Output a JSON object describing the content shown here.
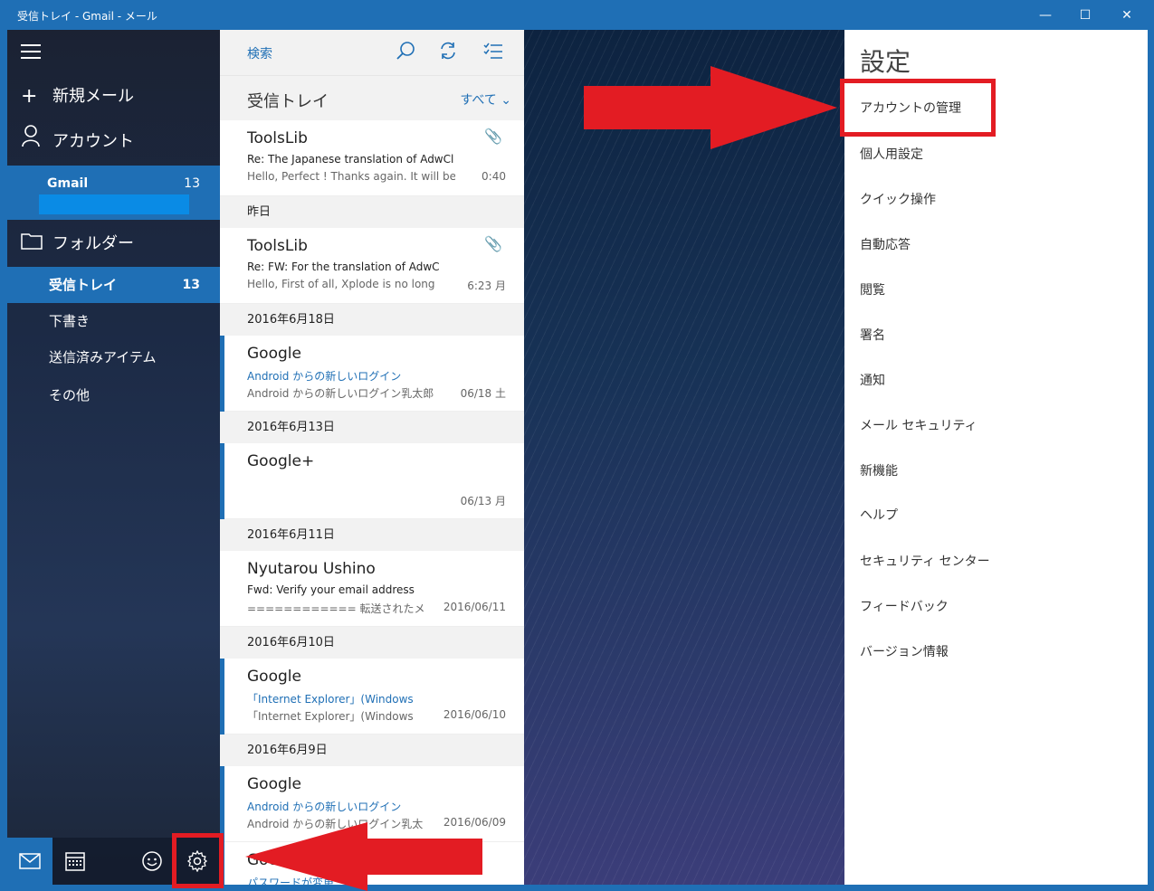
{
  "window": {
    "title": "受信トレイ - Gmail - メール",
    "controls": [
      "—",
      "☐",
      "✕"
    ]
  },
  "nav": {
    "new_mail": "新規メール",
    "accounts": "アカウント",
    "account": {
      "name": "Gmail",
      "count": "13"
    },
    "folders_label": "フォルダー",
    "folders": [
      {
        "label": "受信トレイ",
        "count": "13"
      },
      {
        "label": "下書き",
        "count": ""
      },
      {
        "label": "送信済みアイテム",
        "count": ""
      },
      {
        "label": "その他",
        "count": ""
      }
    ]
  },
  "list": {
    "search_placeholder": "検索",
    "inbox_title": "受信トレイ",
    "filter": "すべて",
    "messages": [
      {
        "from": "ToolsLib",
        "subject": "Re: The Japanese translation of AdwCl",
        "preview": "Hello, Perfect ! Thanks again. It will be",
        "time": "0:40"
      },
      {
        "group": "昨日"
      },
      {
        "from": "ToolsLib",
        "subject": "Re: FW: For the translation of AdwC",
        "preview": "Hello, First of all, Xplode is no long",
        "time": "6:23 月"
      },
      {
        "group": "2016年6月18日"
      },
      {
        "from": "Google",
        "subject": "Android からの新しいログイン",
        "preview": "Android からの新しいログイン乳太郎",
        "time": "06/18 土"
      },
      {
        "group": "2016年6月13日"
      },
      {
        "from": "Google+",
        "subject": "",
        "preview": "",
        "time": "06/13 月"
      },
      {
        "group": "2016年6月11日"
      },
      {
        "from": "Nyutarou Ushino",
        "subject": "Fwd:  Verify your email address",
        "preview": "============ 転送されたメ",
        "time": "2016/06/11"
      },
      {
        "group": "2016年6月10日"
      },
      {
        "from": "Google",
        "subject": "「Internet Explorer」(Windows",
        "preview": "「Internet Explorer」(Windows",
        "time": "2016/06/10"
      },
      {
        "group": "2016年6月9日"
      },
      {
        "from": "Google",
        "subject": "Android からの新しいログイン",
        "preview": "Android からの新しいログイン乳太",
        "time": "2016/06/09"
      },
      {
        "from": "Goo",
        "subject": "パスワードが変更",
        "preview": "",
        "time": ""
      }
    ]
  },
  "settings": {
    "title": "設定",
    "items": [
      "アカウントの管理",
      "個人用設定",
      "クイック操作",
      "自動応答",
      "閲覧",
      "署名",
      "通知",
      "メール セキュリティ",
      "新機能",
      "ヘルプ",
      "セキュリティ センター",
      "フィードバック",
      "バージョン情報"
    ]
  },
  "colors": {
    "accent": "#1f6fb5",
    "annotation": "#e31c23"
  }
}
